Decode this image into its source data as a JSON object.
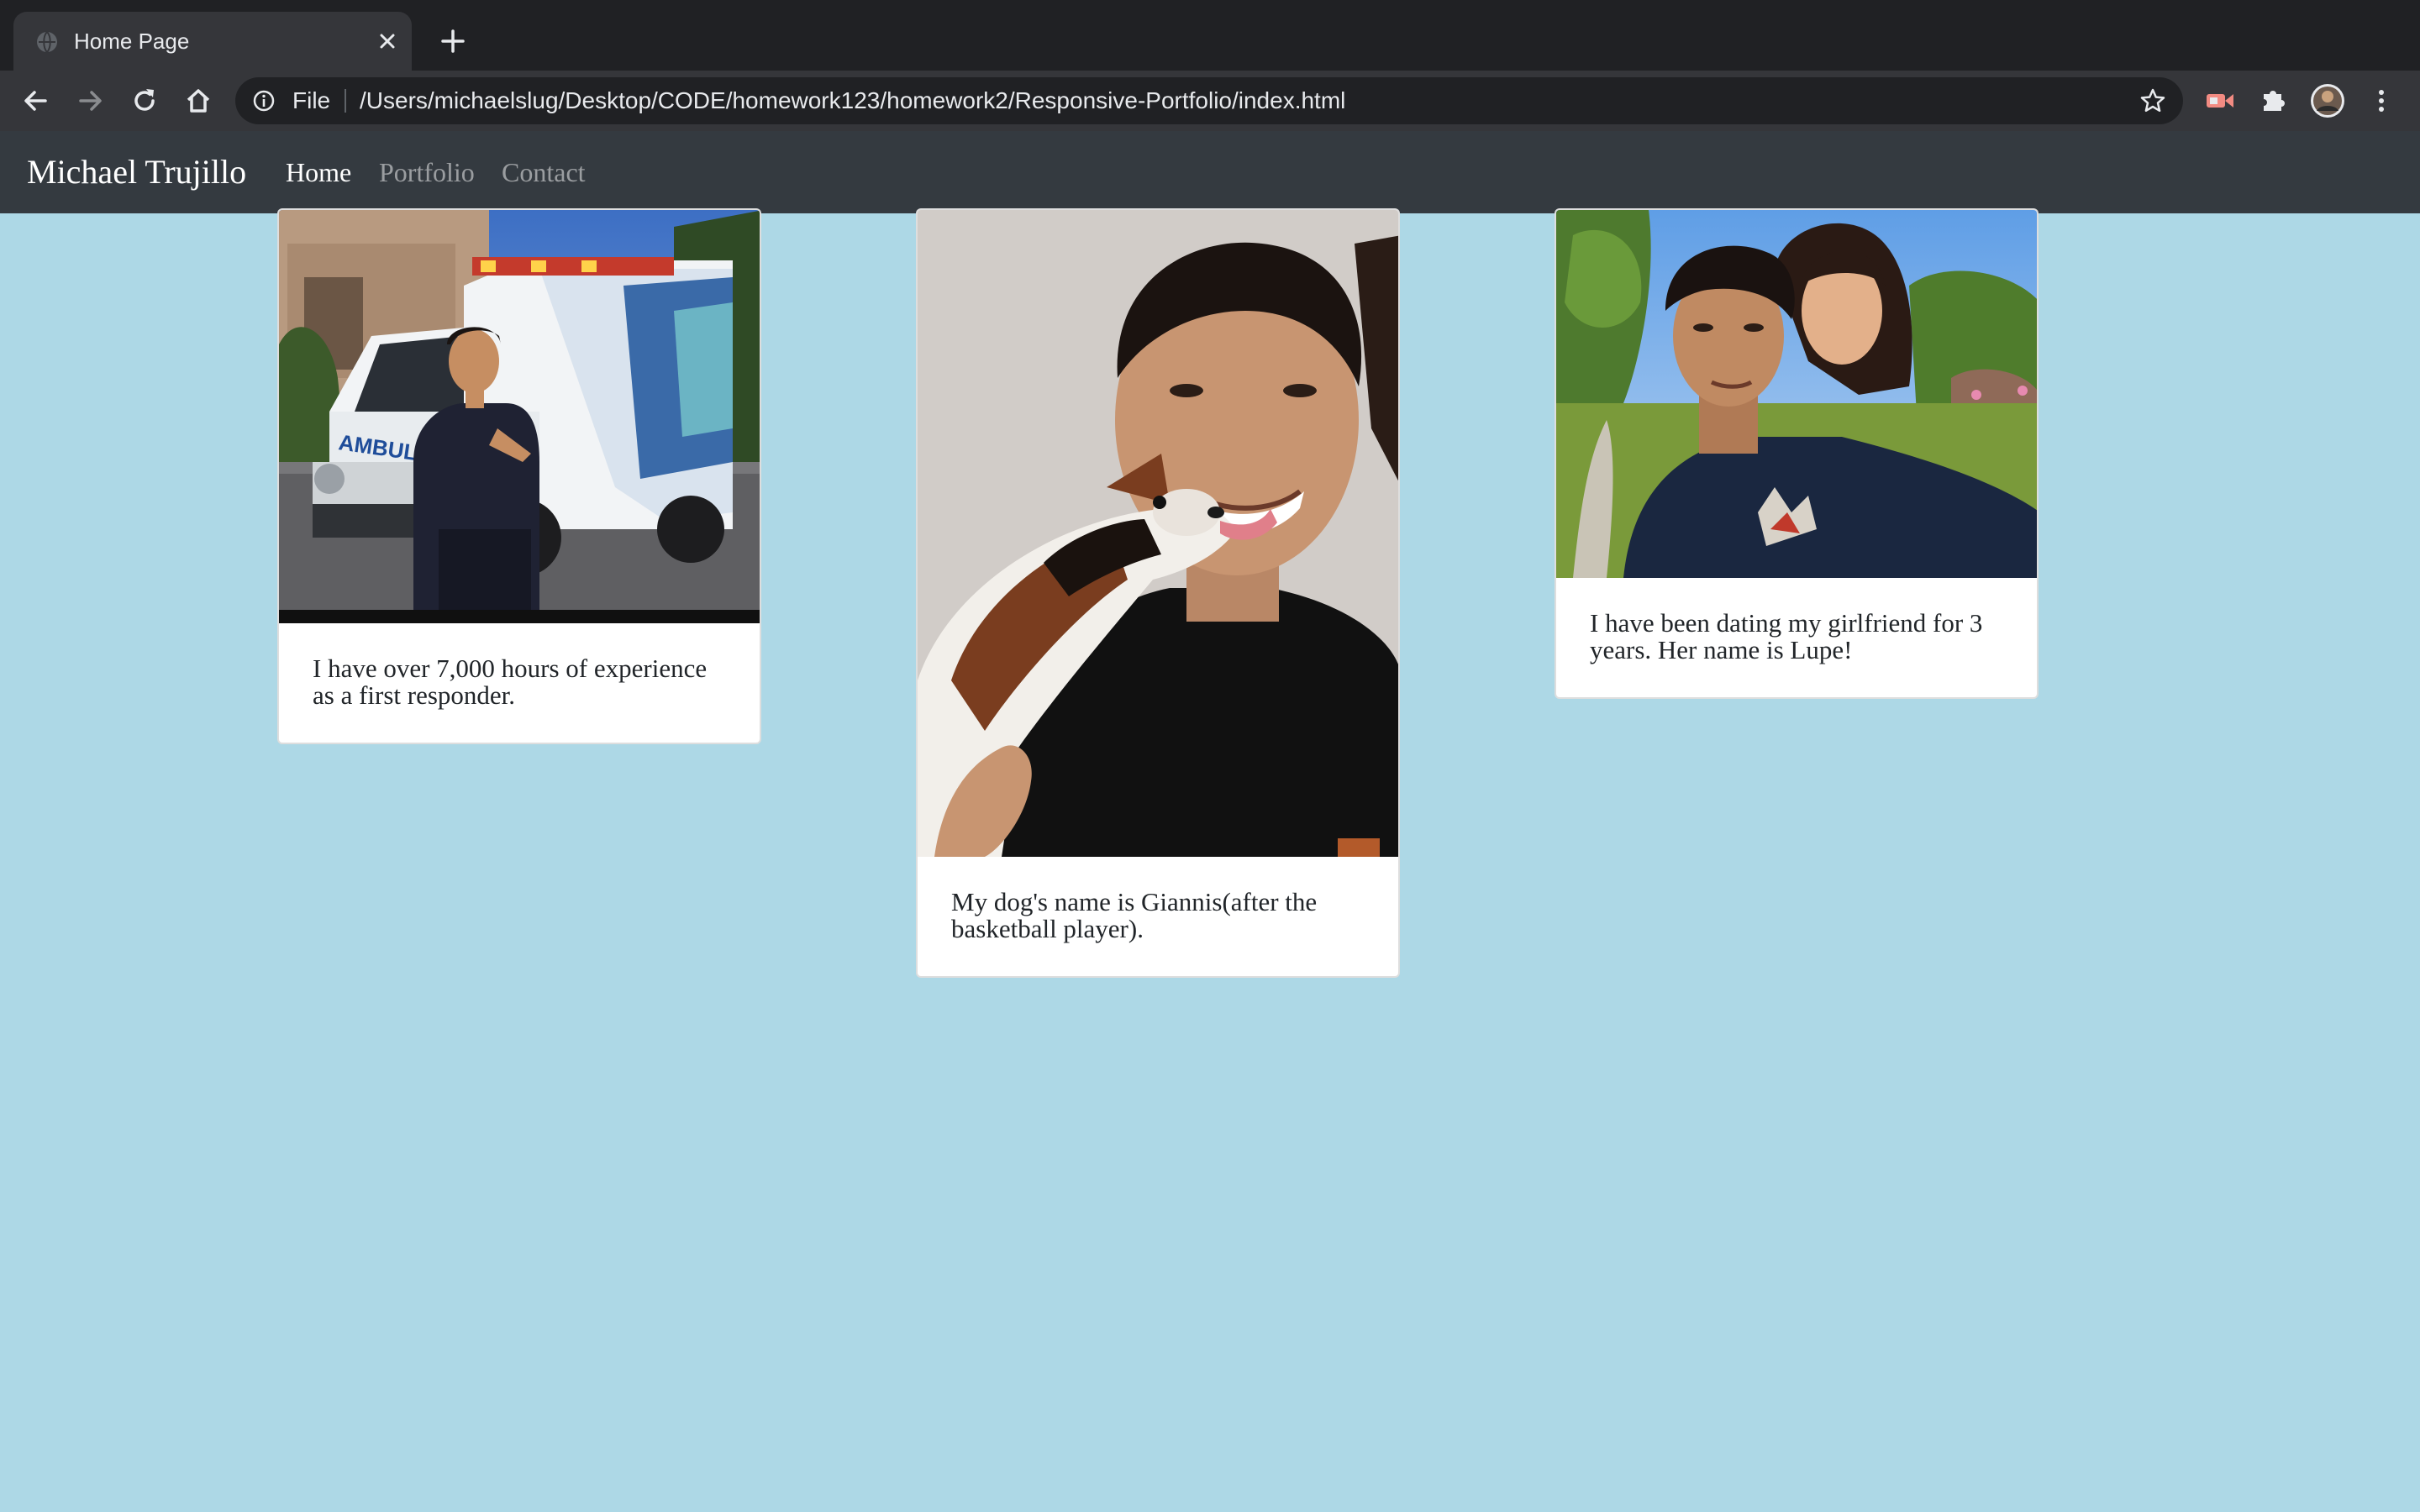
{
  "browser": {
    "tab_title": "Home Page",
    "address_scheme": "File",
    "address_url": "/Users/michaelslug/Desktop/CODE/homework123/homework2/Responsive-Portfolio/index.html",
    "icons": [
      "globe-icon",
      "close-icon",
      "plus-icon",
      "back-arrow-icon",
      "forward-arrow-icon",
      "reload-icon",
      "home-icon",
      "info-icon",
      "star-icon",
      "video-extension-icon",
      "puzzle-icon",
      "avatar",
      "kebab-menu-icon"
    ]
  },
  "navbar": {
    "brand": "Michael Trujillo",
    "links": [
      "Home",
      "Portfolio",
      "Contact"
    ],
    "active_link": "Home",
    "background": "#343a40"
  },
  "page": {
    "background": "#add8e6"
  },
  "cards": [
    {
      "photo": "ambulance-photo",
      "text": "I have over 7,000 hours of experience as a first responder."
    },
    {
      "photo": "dog-photo",
      "text": "My dog's name is Giannis(after the basketball player)."
    },
    {
      "photo": "couple-photo",
      "text": "I have been dating my girlfriend for 3 years. Her name is Lupe!"
    }
  ]
}
